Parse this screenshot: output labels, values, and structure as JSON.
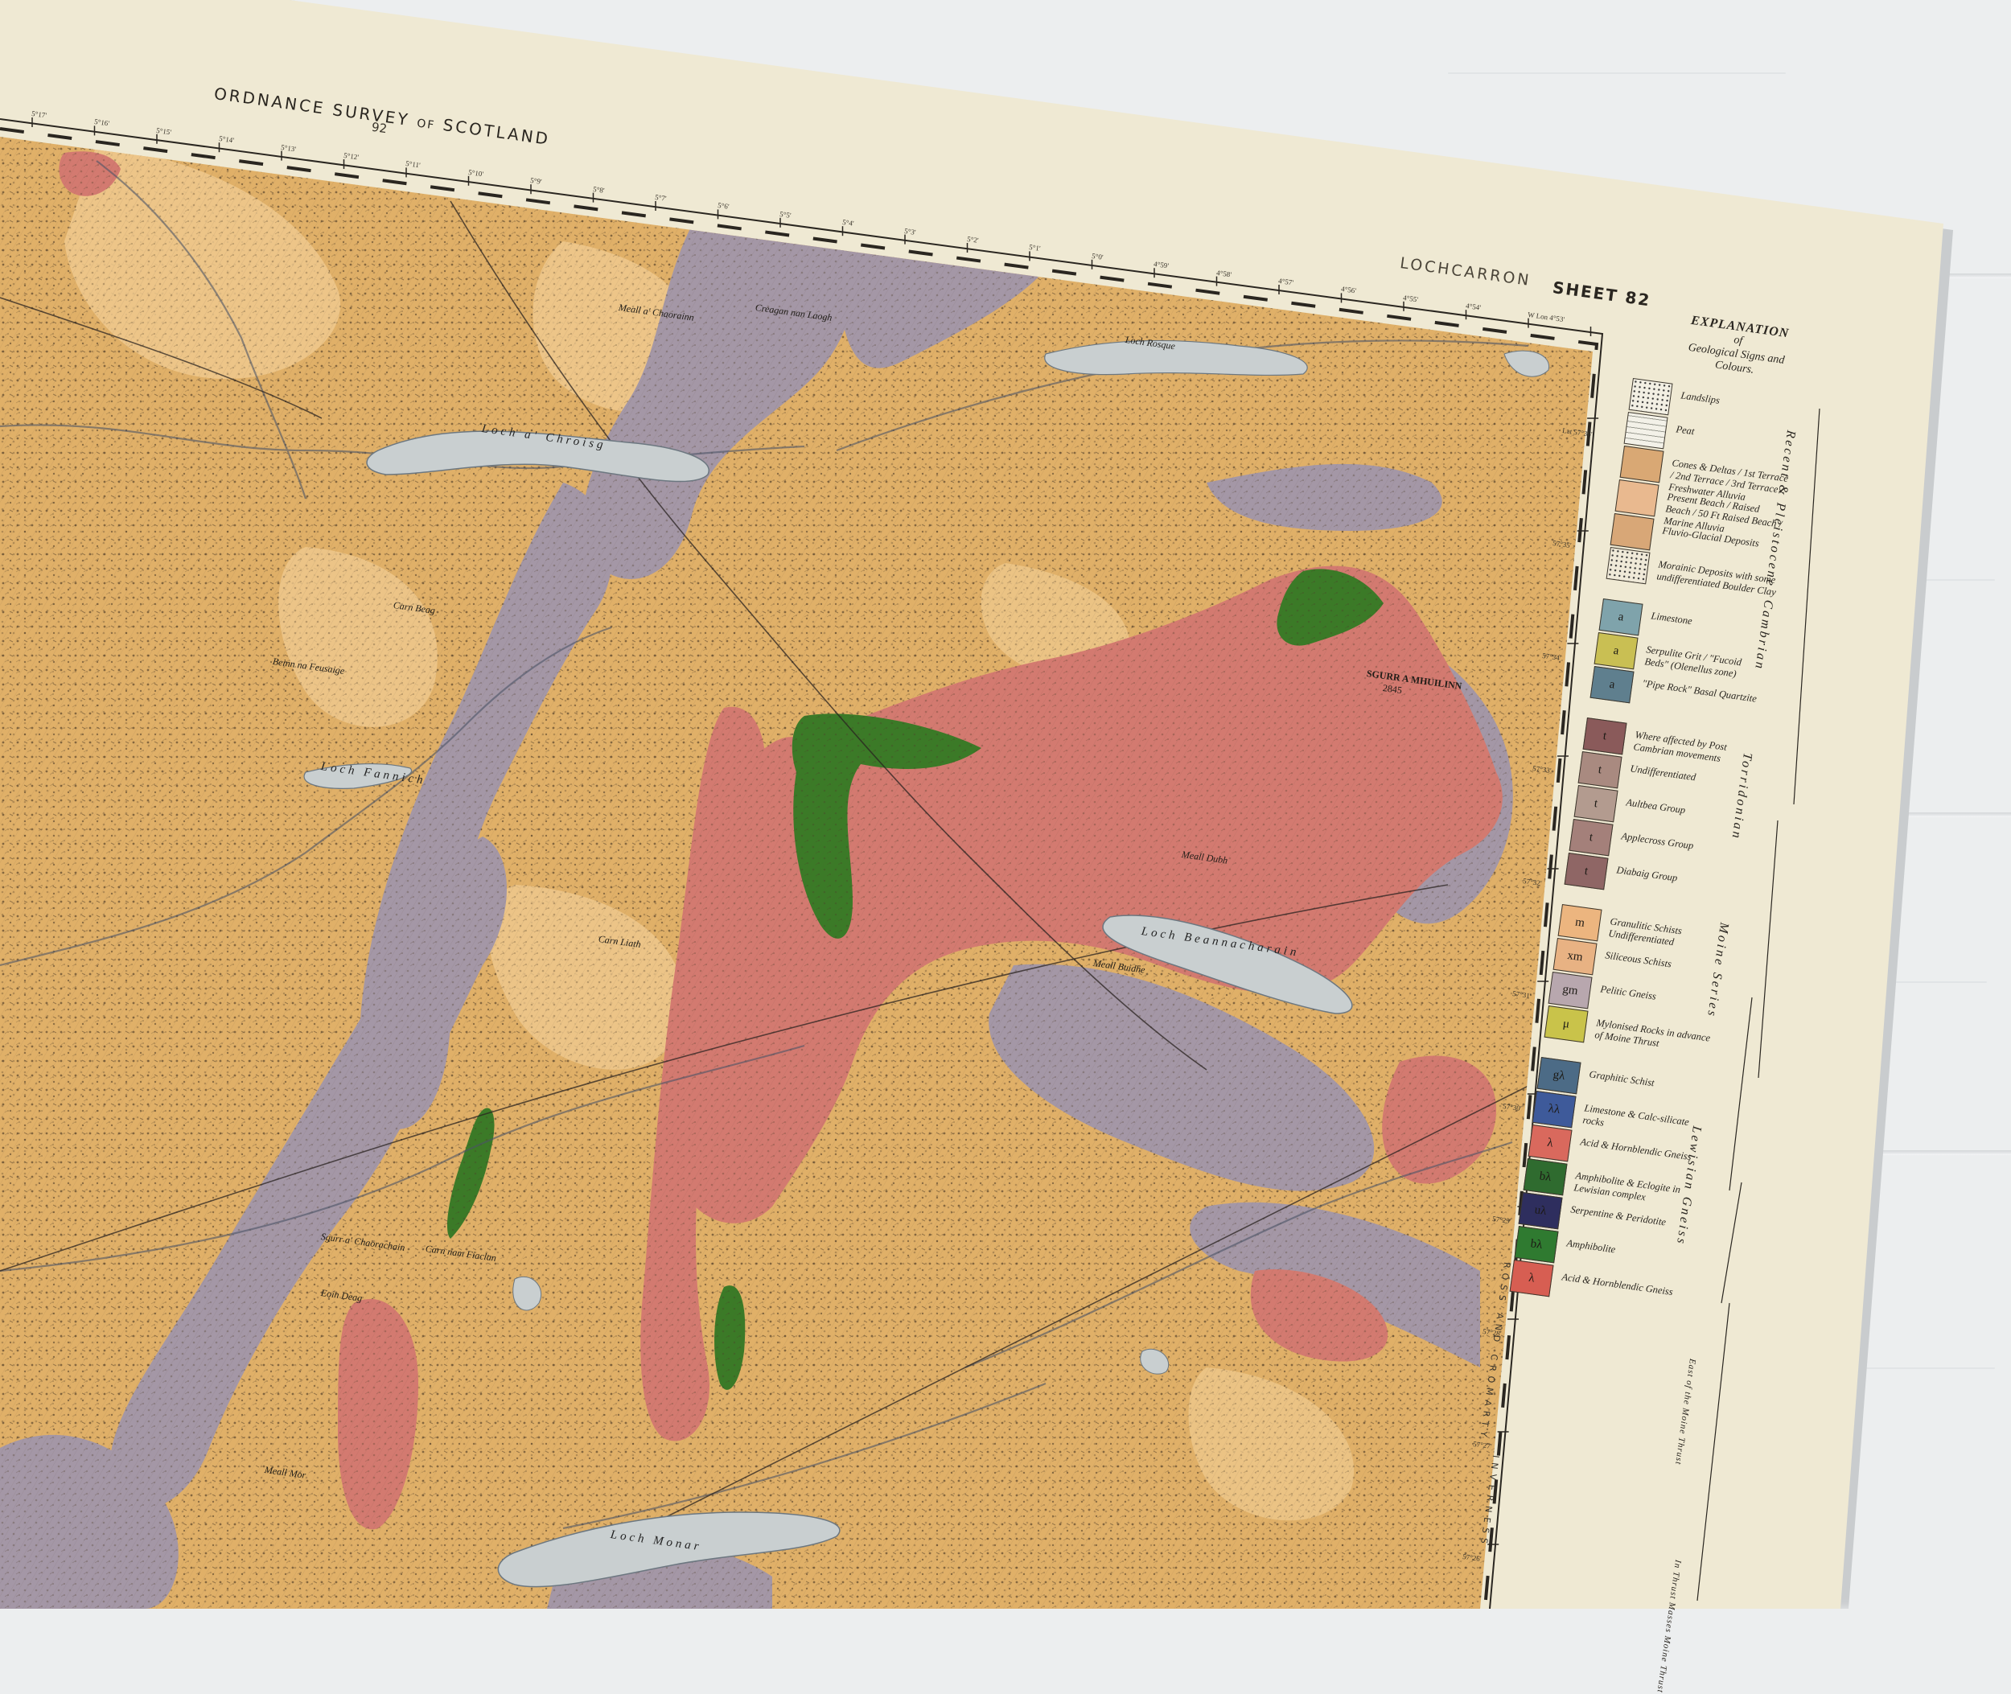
{
  "header": {
    "title_left": "ORDNANCE SURVEY",
    "title_of": "OF",
    "title_right": "SCOTLAND",
    "sheet_number_top": "92",
    "district": "LOCHCARRON",
    "sheet_label": "SHEET 82"
  },
  "longitude_ticks": [
    "5°17'",
    "5°16'",
    "5°15'",
    "5°14'",
    "5°13'",
    "5°12'",
    "5°11'",
    "5°10'",
    "5°9'",
    "5°8'",
    "5°7'",
    "5°6'",
    "5°5'",
    "5°4'",
    "5°3'",
    "5°2'",
    "5°1'",
    "5°0'",
    "4°59'",
    "4°58'",
    "4°57'",
    "4°56'",
    "4°55'",
    "4°54'",
    "W Lon 4°53'"
  ],
  "latitude_ticks": [
    "Lat 57°36'",
    "57°35'",
    "57°34'",
    "57°33'",
    "57°32'",
    "57°31'",
    "57°30'",
    "57°29'",
    "57°28'",
    "57°27'",
    "57°26'"
  ],
  "counties": [
    "ROSS AND CROMARTY",
    "INVERNESS"
  ],
  "map_labels": {
    "loch_a_chroisg": "Loch a' Chroisg",
    "loch_rosque": "Loch Rosque",
    "loch_fannich": "Loch Fannich",
    "loch_beannacharain": "Loch Beannacharain",
    "loch_monar": "Loch Monar",
    "sgurr_a_mhuilinn": "SGURR A MHUILINN",
    "sgurr_a_mhuilinn_height": "2845",
    "meall_a_chaorainn": "Meall a' Chaorainn",
    "carn_beag": "Carn Beag",
    "carn_liath": "Carn Liath",
    "meall_buidhe": "Meall Buidhe",
    "creagan_nan_laogh": "Creagan nan Laogh",
    "meall_mor": "Meall Mor",
    "carn_nam_fiaclan": "Carn nam Fiaclan",
    "beinn_na_feusaige": "Beinn na Feusaige",
    "sgurr_a_chaorachain": "Sgurr a' Chaorachain",
    "eoin_deag": "Eoin Deag",
    "meall_dubh": "Meall Dubh"
  },
  "legend": {
    "heading": "EXPLANATION",
    "heading_of": "of",
    "heading_sub": "Geological Signs and Colours.",
    "groups": [
      {
        "era": "Recent & Pleistocene",
        "items": [
          {
            "symbol": "",
            "label": "Landslips",
            "color": "#f2efe3",
            "pattern": "dots"
          },
          {
            "symbol": "",
            "label": "Peat",
            "color": "#f3f1e8",
            "pattern": "dash"
          },
          {
            "symbol": "",
            "label": "Cones & Deltas / 1st Terrace / 2nd Terrace / 3rd Terrace / Freshwater Alluvia",
            "color": "#d9a874",
            "pattern": "plain"
          },
          {
            "symbol": "",
            "label": "Present Beach / Raised Beach / 50 Ft Raised Beach / Marine Alluvia",
            "color": "#e9b98f",
            "pattern": "plain"
          },
          {
            "symbol": "",
            "label": "Fluvio-Glacial Deposits",
            "color": "#d8a777",
            "pattern": "plain"
          },
          {
            "symbol": "",
            "label": "Morainic Deposits with some undifferentiated Boulder Clay",
            "color": "#efe9d8",
            "pattern": "dots"
          }
        ]
      },
      {
        "era": "Cambrian",
        "items": [
          {
            "symbol": "a",
            "label": "Limestone",
            "color": "#7fa3ab",
            "pattern": "plain"
          },
          {
            "symbol": "a",
            "label": "Serpulite Grit / \"Fucoid Beds\" (Olenellus zone)",
            "color": "#c9bf53",
            "pattern": "plain"
          },
          {
            "symbol": "a",
            "label": "\"Pipe Rock\" Basal Quartzite",
            "color": "#5f7f8e",
            "pattern": "plain"
          }
        ]
      },
      {
        "era": "Torridonian",
        "items": [
          {
            "symbol": "t",
            "label": "Where affected by Post Cambrian movements",
            "color": "#8a5a5a",
            "pattern": "plain"
          },
          {
            "symbol": "t",
            "label": "Undifferentiated",
            "color": "#a98a80",
            "pattern": "plain"
          },
          {
            "symbol": "t",
            "label": "Aultbea Group",
            "color": "#b39b8f",
            "pattern": "plain"
          },
          {
            "symbol": "t",
            "label": "Applecross Group",
            "color": "#a4807a",
            "pattern": "plain"
          },
          {
            "symbol": "t",
            "label": "Diabaig Group",
            "color": "#8f6665",
            "pattern": "plain"
          }
        ]
      },
      {
        "era": "Moine Series",
        "items": [
          {
            "symbol": "m",
            "label": "Granulitic Schists Undifferentiated",
            "color": "#ecb57f",
            "pattern": "plain"
          },
          {
            "symbol": "xm",
            "label": "Siliceous Schists",
            "color": "#e8b283",
            "pattern": "plain"
          },
          {
            "symbol": "gm",
            "label": "Pelitic Gneiss",
            "color": "#b8a7ae",
            "pattern": "plain"
          },
          {
            "symbol": "μ",
            "label": "Mylonised Rocks in advance of Moine Thrust",
            "color": "#c9c34a",
            "pattern": "plain"
          }
        ]
      },
      {
        "era": "Lewisian Gneiss",
        "items": [
          {
            "symbol": "gλ",
            "label": "Graphitic Schist",
            "color": "#4c6b86",
            "pattern": "plain"
          },
          {
            "symbol": "λλ",
            "label": "Limestone & Calc-silicate rocks",
            "color": "#3e5a9a",
            "pattern": "plain"
          },
          {
            "symbol": "λ",
            "label": "Acid & Hornblendic Gneiss",
            "color": "#d9695d",
            "pattern": "plain"
          },
          {
            "symbol": "bλ",
            "label": "Amphibolite & Eclogite in Lewisian complex",
            "color": "#2f6b2f",
            "pattern": "plain"
          },
          {
            "symbol": "uλ",
            "label": "Serpentine & Peridotite",
            "color": "#2e2e5e",
            "pattern": "plain"
          },
          {
            "symbol": "bλ",
            "label": "Amphibolite",
            "color": "#2f7a30",
            "pattern": "plain"
          },
          {
            "symbol": "λ",
            "label": "Acid & Hornblendic Gneiss",
            "color": "#d75e52",
            "pattern": "plain"
          }
        ]
      }
    ],
    "notes": [
      "East of the Moine Thrust",
      "In Thrust Masses Moine Thrust"
    ]
  },
  "colors": {
    "paper": "#efe9d3",
    "moine_ochre": "#e3b56c",
    "moine_pale": "#efc98e",
    "pelitic_mauve": "#a497a6",
    "lewisian_pink": "#d37a70",
    "amphibolite_green": "#3b7a27",
    "loch_water": "#c9cfd0",
    "wood_floor": "#eceeef"
  }
}
